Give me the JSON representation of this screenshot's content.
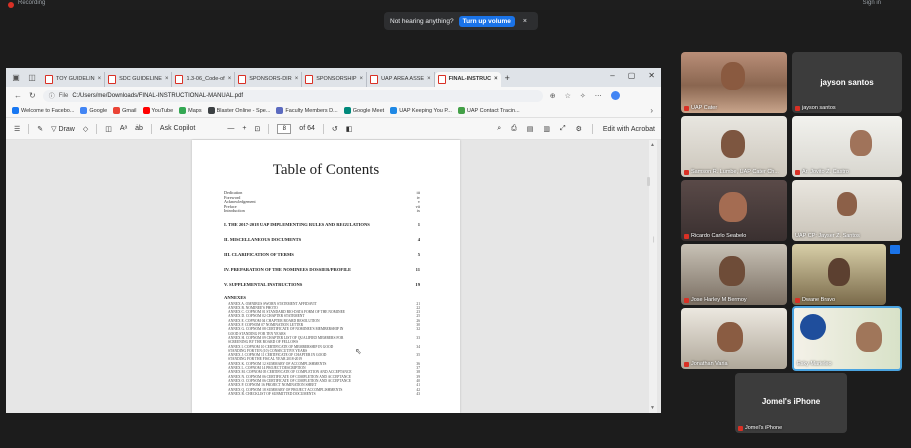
{
  "meeting": {
    "recording_label": "Recording",
    "signin_label": "Sign in",
    "toast_message": "Not hearing anything?",
    "toast_button": "Turn up volume",
    "toast_close": "×"
  },
  "browser": {
    "tabs": [
      {
        "label": "TOY GUIDELIN",
        "active": false
      },
      {
        "label": "SDC GUIDELINE",
        "active": false
      },
      {
        "label": "1.3-06_Code-of",
        "active": false
      },
      {
        "label": "SPONSORS-DIR",
        "active": false
      },
      {
        "label": "SPONSORSHIP",
        "active": false
      },
      {
        "label": "UAP AREA ASSE",
        "active": false
      },
      {
        "label": "FINAL-INSTRUC",
        "active": true
      }
    ],
    "tab_close": "×",
    "new_tab": "+",
    "window_controls": [
      "–",
      "▢",
      "✕"
    ],
    "address_info": "File",
    "url": "C:/Users/me/Downloads/FINAL-INSTRUCTIONAL-MANUAL.pdf",
    "bookmarks": [
      {
        "label": "Welcome to Facebo...",
        "color": "#1877f2"
      },
      {
        "label": "Google",
        "color": "#4285f4"
      },
      {
        "label": "Gmail",
        "color": "#ea4335"
      },
      {
        "label": "YouTube",
        "color": "#ff0000"
      },
      {
        "label": "Maps",
        "color": "#34a853"
      },
      {
        "label": "Blaster Online - Spe...",
        "color": "#3c4043"
      },
      {
        "label": "Faculty Members D...",
        "color": "#5c6bc0"
      },
      {
        "label": "Google Meet",
        "color": "#00897b"
      },
      {
        "label": "UAP Keeping You P...",
        "color": "#1e88e5"
      },
      {
        "label": "UAP Contact Tracin...",
        "color": "#43a047"
      }
    ],
    "bookmarks_more": "›"
  },
  "pdf_toolbar": {
    "draw_label": "Draw",
    "ask_copilot": "Ask Copilot",
    "zoom_out": "—",
    "zoom_in": "+",
    "current_page": "8",
    "page_total": "of 64",
    "edit_acrobat": "Edit with Acrobat"
  },
  "document": {
    "title": "Table of Contents",
    "front_matter": [
      {
        "label": "Dedication",
        "page": "iii"
      },
      {
        "label": "Foreword",
        "page": "iv"
      },
      {
        "label": "Acknowledgement",
        "page": "v"
      },
      {
        "label": "Preface",
        "page": "vii"
      },
      {
        "label": "Introduction",
        "page": "ix"
      }
    ],
    "sections": [
      {
        "label": "I. THE 2017-2018 UAP IMPLEMENTING RULES AND REGULATIONS",
        "page": "1"
      },
      {
        "label": "II. MISCELLANEOUS DOCUMENTS",
        "page": "4"
      },
      {
        "label": "III. CLARIFICATION OF TERMS",
        "page": "5"
      },
      {
        "label": "IV. PREPARATION OF THE NOMINEES DOSSIER/PROFILE",
        "page": "11"
      },
      {
        "label": "V. SUPPLEMENTAL INSTRUCTIONS",
        "page": "19"
      }
    ],
    "annexes_heading": "ANNEXES",
    "annexes": [
      {
        "label": "ANNEX A. OMNIBUS SWORN STATEMENT AFFIDAVIT",
        "page": "21"
      },
      {
        "label": "ANNEX B. NOMINEE'S PHOTO",
        "page": "22"
      },
      {
        "label": "ANNEX C. COPNOM 01 STANDARD BIO-DATA FORM OF THE NOMINEE",
        "page": "23"
      },
      {
        "label": "ANNEX D. COPNOM 02 CHAPTER STATEMENT",
        "page": "25"
      },
      {
        "label": "ANNEX E. COPNOM 04 CHAPTER BOARD RESOLUTION",
        "page": "26"
      },
      {
        "label": "ANNEX F. COPNOM 07 NOMINATION LETTER",
        "page": "30"
      },
      {
        "label": "ANNEX G. COPNOM 08 CERTIFICATE OF NOMINEE'S MEMBERSHIP IN",
        "page": "32"
      },
      {
        "label": "GOOD STANDING FOR TEN YEARS",
        "page": ""
      },
      {
        "label": "ANNEX H. COPNOM 09 CHAPTER LIST OF QUALIFIED MEMBERS FOR",
        "page": "33"
      },
      {
        "label": "SCREENING BY THE BOARD OF FELLOWS",
        "page": ""
      },
      {
        "label": "ANNEX I. COPNOM 10 CERTIFICATE OF MEMBERSHIP IN GOOD",
        "page": "34"
      },
      {
        "label": "STANDING FOR TEN (10) CONSECUTIVE YEARS",
        "page": ""
      },
      {
        "label": "ANNEX J. COPNOM 11 CERTIFICATE OF CHAPTER IN GOOD",
        "page": "35"
      },
      {
        "label": "STANDING FOR THE FISCAL YEAR 2018-2019",
        "page": ""
      },
      {
        "label": "ANNEX K. COPNOM 12 SUMMARY OF ACCOMPLISHMENTS",
        "page": "36"
      },
      {
        "label": "ANNEX L. COPNOM 14 PROJECT DESCRIPTION",
        "page": "37"
      },
      {
        "label": "ANNEX M. COPNOM 05 CERTIFICATE OF COMPLETION AND ACCEPTANCE",
        "page": "38"
      },
      {
        "label": "ANNEX N. COPNOM 06 CERTIFICATE OF COMPLETION AND ACCEPTANCE",
        "page": "39"
      },
      {
        "label": "ANNEX O. COPNOM 06 CERTIFICATE OF COMPLETION AND ACCEPTANCE",
        "page": "40"
      },
      {
        "label": "ANNEX P. COPNOM 16 PROJECT NOMINATION SHEET",
        "page": "41"
      },
      {
        "label": "ANNEX Q. COPNOM 18 SUMMARY OF PROJECT ACCOMPLISHMENTS",
        "page": "42"
      },
      {
        "label": "ANNEX R. CHECKLIST OF SUBMITTED DOCUMENTS",
        "page": "43"
      }
    ]
  },
  "participants": {
    "top_left_tile": "UAP Cater",
    "jayson_big": "jayson santos",
    "jayson_small": "jayson santos",
    "tile_3": "Samson R. Lumbe, UAP Cater Ch...",
    "tile_4": "Ar. Jovito Z. Castro",
    "tile_5": "Ricardo Carlo Seabelo",
    "tile_6": "UAP CP: Jayser Z. Santos",
    "tile_7": "Jose Harley M Bermoy",
    "tile_8": "Dwane Bravo",
    "tile_9": "Jonathan Varia",
    "tile_10": "Esky Marieleo",
    "phone_big": "Jomel's iPhone",
    "phone_small": "Jomel's iPhone"
  }
}
